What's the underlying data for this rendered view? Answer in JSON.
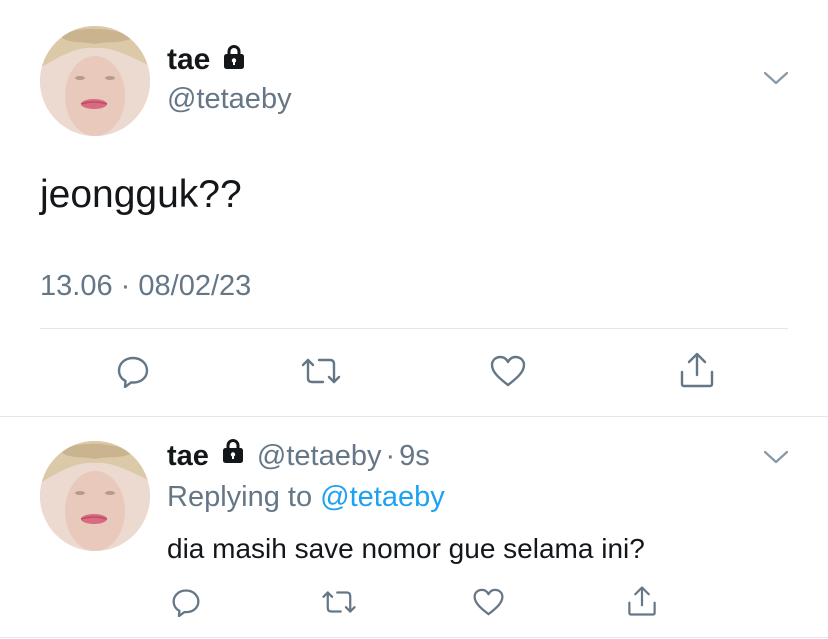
{
  "main_tweet": {
    "display_name": "tae",
    "handle": "@tetaeby",
    "text": "jeongguk??",
    "time": "13.06",
    "separator": "·",
    "date": "08/02/23",
    "protected": true
  },
  "reply_tweet": {
    "display_name": "tae",
    "handle": "@tetaeby",
    "separator": "·",
    "age": "9s",
    "replying_label": "Replying to",
    "replying_handle": "@tetaeby",
    "text": "dia masih save nomor gue selama ini?",
    "protected": true
  },
  "icons": {
    "more": "chevron-down-icon",
    "lock": "lock-icon",
    "reply": "speech-bubble-icon",
    "retweet": "retweet-icon",
    "like": "heart-icon",
    "share": "share-upload-icon"
  },
  "colors": {
    "text": "#14171a",
    "secondary": "#657786",
    "link": "#1da1f2",
    "divider": "#e1e8ed"
  }
}
